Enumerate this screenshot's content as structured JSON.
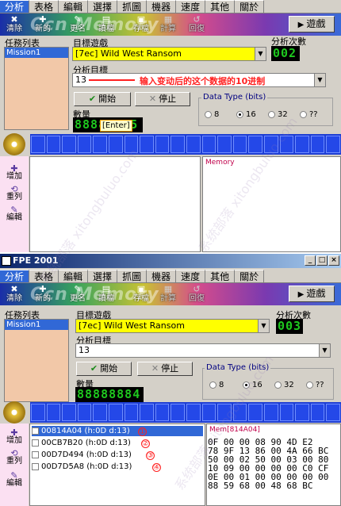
{
  "panel1": {
    "tabs": [
      "分析",
      "表格",
      "編輯",
      "選擇",
      "抓圖",
      "機器",
      "速度",
      "其他",
      "關於"
    ],
    "toolbar": {
      "brand": "Ccn Memory",
      "items": [
        "清除",
        "新的",
        "更名",
        "讀檔",
        "存檔",
        "計算",
        "回復"
      ],
      "game_button": "遊戲"
    },
    "task_list_label": "任務列表",
    "task_items": [
      "Mission1"
    ],
    "target_game_label": "目標遊戲",
    "target_game_value": "[7ec] Wild West Ransom",
    "analysis_count_label": "分析次數",
    "analysis_count_value": "002",
    "analysis_target_label": "分析目標",
    "analysis_target_value": "13",
    "annotation": "输入变动后的这个数据的10进制",
    "start_button": "開始",
    "stop_button": "停止",
    "quantity_label": "數量",
    "quantity_value": "88888885",
    "enter_tooltip": "[Enter]",
    "data_type_title": "Data Type (bits)",
    "data_types": [
      "8",
      "16",
      "32",
      "??"
    ],
    "data_type_selected": "16",
    "left_tools": [
      "增加",
      "重列",
      "編輯"
    ],
    "memory_title": "Memory"
  },
  "panel2": {
    "window_title": "FPE 2001",
    "tabs": [
      "分析",
      "表格",
      "編輯",
      "選擇",
      "抓圖",
      "機器",
      "速度",
      "其他",
      "關於"
    ],
    "toolbar": {
      "brand": "Ccn Memory",
      "items": [
        "清除",
        "新的",
        "更名",
        "讀檔",
        "存檔",
        "計算",
        "回復"
      ],
      "game_button": "遊戲"
    },
    "task_list_label": "任務列表",
    "task_items": [
      "Mission1"
    ],
    "target_game_label": "目標遊戲",
    "target_game_value": "[7ec] Wild West Ransom",
    "analysis_count_label": "分析次數",
    "analysis_count_value": "003",
    "analysis_target_label": "分析目標",
    "analysis_target_value": "13",
    "start_button": "開始",
    "stop_button": "停止",
    "quantity_label": "數量",
    "quantity_value": "88888884",
    "data_type_title": "Data Type (bits)",
    "data_types": [
      "8",
      "16",
      "32",
      "??"
    ],
    "data_type_selected": "16",
    "left_tools": [
      "增加",
      "重列",
      "編輯"
    ],
    "addresses": [
      {
        "text": "00814A04 (h:0D d:13)",
        "mark": "①"
      },
      {
        "text": "00CB7B20 (h:0D d:13)",
        "mark": "②"
      },
      {
        "text": "00D7D494 (h:0D d:13)",
        "mark": "③"
      },
      {
        "text": "00D7D5A8 (h:0D d:13)",
        "mark": "④"
      }
    ],
    "memory_title": "Mem[814A04]",
    "hex_lines": [
      "0F 00 00 08 90 4D E2",
      "78 9F 13 86 00 4A 66 BC",
      "50 00 02 50 00 03 00 80",
      "10 09 00 00 00 00 C0 CF",
      "0E 00 01 00 00 00 00 00",
      "88 59 68 00 48 68 BC"
    ]
  },
  "watermark": "系统部落 xitongbuluo.com"
}
